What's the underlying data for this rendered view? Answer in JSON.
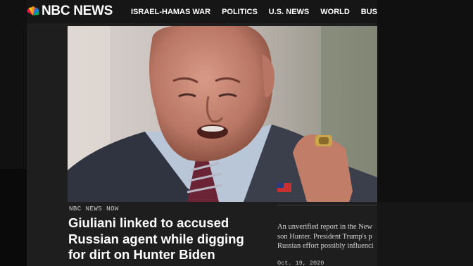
{
  "site": {
    "brand": "NBC NEWS"
  },
  "nav": {
    "items": [
      "ISRAEL-HAMAS WAR",
      "POLITICS",
      "U.S. NEWS",
      "WORLD",
      "BUSINESS"
    ]
  },
  "article": {
    "kicker": "NBC NEWS NOW",
    "headline": "Giuliani linked to accused Russian agent while digging for dirt on Hunter Biden",
    "dek_lines": [
      "An unverified report in the New",
      "son Hunter. President Trump's p",
      "Russian effort possibly influenci"
    ],
    "date": "Oct. 19, 2020"
  },
  "colors": {
    "nav_bg": "#161616",
    "page_bg": "#1e1e1e",
    "text": "#ffffff"
  }
}
